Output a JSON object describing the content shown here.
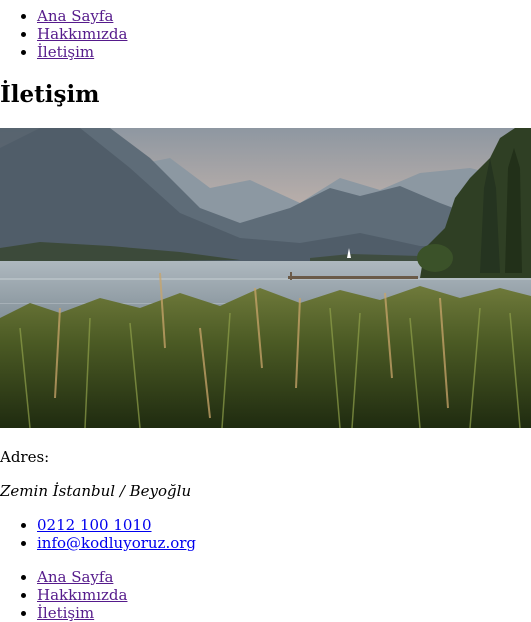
{
  "nav_top": {
    "items": [
      {
        "label": "Ana Sayfa"
      },
      {
        "label": "Hakkımızda"
      },
      {
        "label": "İletişim"
      }
    ]
  },
  "page_title": "İletişim",
  "hero_image": {
    "alt": "Göl ve dağ manzarası"
  },
  "address": {
    "label": "Adres:",
    "value": "Zemin İstanbul / Beyoğlu"
  },
  "contact": {
    "phone": "0212 100 1010",
    "email": "info@kodluyoruz.org"
  },
  "nav_bottom": {
    "items": [
      {
        "label": "Ana Sayfa"
      },
      {
        "label": "Hakkımızda"
      },
      {
        "label": "İletişim"
      }
    ]
  },
  "colors": {
    "visited_link": "#551a8b",
    "link": "#0000ee"
  }
}
